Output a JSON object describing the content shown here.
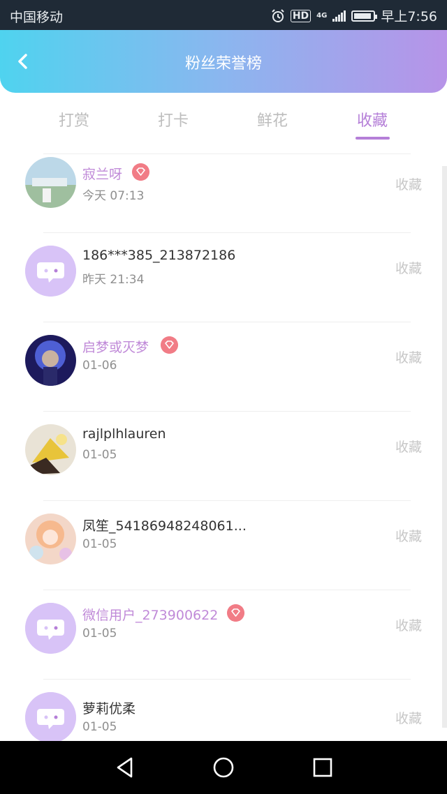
{
  "status_bar": {
    "carrier": "中国移动",
    "network": "4G",
    "hd": "HD",
    "time": "早上7:56"
  },
  "header": {
    "title": "粉丝荣誉榜"
  },
  "tabs": [
    {
      "label": "打赏",
      "active": false
    },
    {
      "label": "打卡",
      "active": false
    },
    {
      "label": "鲜花",
      "active": false
    },
    {
      "label": "收藏",
      "active": true
    }
  ],
  "fans": [
    {
      "name": "寂兰呀",
      "time": "今天 07:13",
      "action": "收藏",
      "vip": true,
      "avatar": "photo-landscape"
    },
    {
      "name": "186***385_213872186",
      "time": "昨天 21:34",
      "action": "收藏",
      "vip": false,
      "avatar": "default-chat"
    },
    {
      "name": "启梦或灭梦",
      "time": "01-06",
      "action": "收藏",
      "vip": true,
      "avatar": "photo-anime-blue"
    },
    {
      "name": "rajlplhlauren",
      "time": "01-05",
      "action": "收藏",
      "vip": false,
      "avatar": "photo-yellow-object"
    },
    {
      "name": "凤笙_54186948248061...",
      "time": "01-05",
      "action": "收藏",
      "vip": false,
      "avatar": "photo-anime-girl"
    },
    {
      "name": "微信用户_273900622",
      "time": "01-05",
      "action": "收藏",
      "vip": true,
      "avatar": "default-chat"
    },
    {
      "name": "萝莉优柔",
      "time": "01-05",
      "action": "收藏",
      "vip": false,
      "avatar": "default-chat"
    }
  ],
  "colors": {
    "accent": "#b57fd8",
    "vip_name": "#c08ad8",
    "gem": "#f17c86",
    "header_from": "#4fd3ef",
    "header_to": "#b793e8"
  },
  "nav_icons": [
    "back-triangle-icon",
    "home-circle-icon",
    "recent-square-icon"
  ]
}
